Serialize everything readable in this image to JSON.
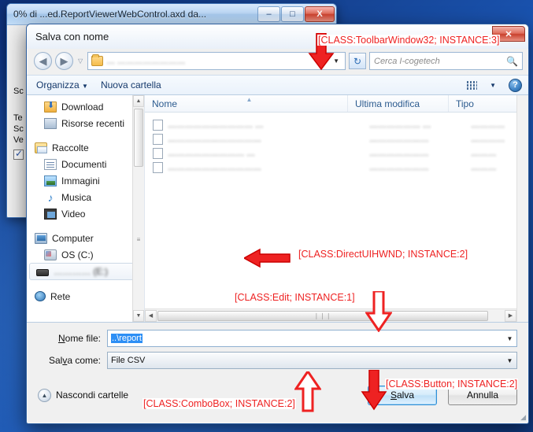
{
  "owner_window": {
    "title": "0% di ...ed.ReportViewerWebControl.axd da...",
    "title_blurred_suffix": "da.……… ...",
    "minimize_label": "–",
    "maximize_label": "□",
    "close_label": "X",
    "visible_text_fragments": [
      "Sc",
      "Te",
      "Sc",
      "Ve"
    ]
  },
  "dialog": {
    "title": "Salva con nome",
    "close_label": "✕",
    "nav": {
      "back_label": "◀",
      "forward_label": "▶",
      "dropdown_label": "▽",
      "address_value": "… ……………………",
      "address_arrow": "▼",
      "refresh_label": "↻"
    },
    "search": {
      "placeholder": "Cerca I-cogetech",
      "icon": "search-icon"
    },
    "toolbar": {
      "organize_label": "Organizza",
      "organize_caret": "▼",
      "new_folder_label": "Nuova cartella",
      "view_caret": "▼",
      "help_label": "?"
    },
    "nav_pane": {
      "items": [
        {
          "label": "Download",
          "icon": "download-folder-icon",
          "type": "item",
          "selected": false
        },
        {
          "label": "Risorse recenti",
          "icon": "recent-places-icon",
          "type": "item",
          "selected": false
        },
        {
          "label": "Raccolte",
          "icon": "libraries-icon",
          "type": "group",
          "selected": false
        },
        {
          "label": "Documenti",
          "icon": "documents-icon",
          "type": "item",
          "selected": false
        },
        {
          "label": "Immagini",
          "icon": "pictures-icon",
          "type": "item",
          "selected": false
        },
        {
          "label": "Musica",
          "icon": "music-icon",
          "type": "item",
          "selected": false
        },
        {
          "label": "Video",
          "icon": "video-icon",
          "type": "item",
          "selected": false
        },
        {
          "label": "Computer",
          "icon": "computer-icon",
          "type": "group",
          "selected": false
        },
        {
          "label": "OS (C:)",
          "icon": "local-disk-icon",
          "type": "item",
          "selected": false
        },
        {
          "label": "………… (E:)",
          "icon": "removable-drive-icon",
          "type": "item",
          "selected": true
        },
        {
          "label": "Rete",
          "icon": "network-icon",
          "type": "group",
          "selected": false
        }
      ],
      "scroll_up": "▲",
      "scroll_down": "▼",
      "grip": "≡"
    },
    "file_list": {
      "columns": [
        "Nome",
        "Ultima modifica",
        "Tipo"
      ],
      "sort_indicator": "▲",
      "rows": [
        {
          "name": "………………………… …",
          "modified": "……………… …",
          "type": "…………"
        },
        {
          "name": "……………………………",
          "modified": "…………………",
          "type": "…………"
        },
        {
          "name": "……………………… …",
          "modified": "…………………",
          "type": "………"
        },
        {
          "name": "……………………………",
          "modified": "…………………",
          "type": "………"
        }
      ],
      "hscroll": {
        "left": "◀",
        "right": "▶",
        "grip": "❘❘❘"
      }
    },
    "form": {
      "filename_label": "Nome file:",
      "filename_value": "..\\report",
      "filename_arrow": "▼",
      "savetype_label": "Salva come:",
      "savetype_value": "File CSV",
      "savetype_arrow": "▼"
    },
    "footer": {
      "hide_folders_label": "Nascondi cartelle",
      "hide_folders_icon": "▲",
      "save_label": "Salva",
      "cancel_label": "Annulla",
      "grip_icon": "resize-grip-icon"
    }
  },
  "annotations": {
    "color": "#ee2222",
    "items": [
      {
        "id": "toolbarwindow32",
        "text": "[CLASS:ToolbarWindow32; INSTANCE:3]"
      },
      {
        "id": "directuihwnd",
        "text": "[CLASS:DirectUIHWND; INSTANCE:2]"
      },
      {
        "id": "edit",
        "text": "[CLASS:Edit; INSTANCE:1]"
      },
      {
        "id": "combobox",
        "text": "[CLASS:ComboBox; INSTANCE:2]"
      },
      {
        "id": "button",
        "text": "[CLASS:Button; INSTANCE:2]"
      }
    ]
  }
}
